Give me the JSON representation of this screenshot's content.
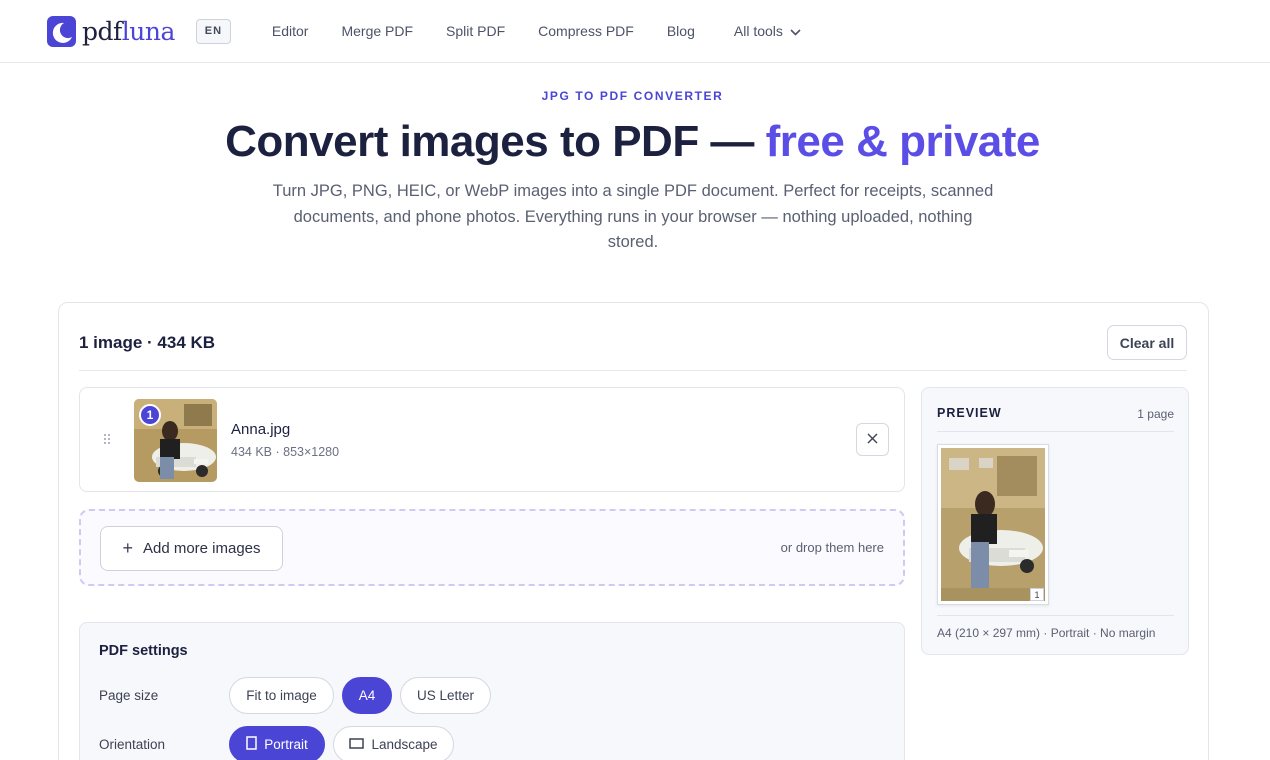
{
  "header": {
    "brand_pdf": "pdf",
    "brand_luna": "luna",
    "lang": "EN",
    "nav": [
      "Editor",
      "Merge PDF",
      "Split PDF",
      "Compress PDF",
      "Blog"
    ],
    "all_tools": "All tools"
  },
  "hero": {
    "eyebrow": "JPG TO PDF CONVERTER",
    "title_main": "Convert images to PDF — ",
    "title_accent": "free & private",
    "subtitle": "Turn JPG, PNG, HEIC, or WebP images into a single PDF document. Perfect for receipts, scanned documents, and phone photos. Everything runs in your browser — nothing uploaded, nothing stored."
  },
  "workspace": {
    "count": "1 image · 434 KB",
    "clear_all": "Clear all",
    "files": [
      {
        "index": "1",
        "name": "Anna.jpg",
        "meta": "434 KB · 853×1280"
      }
    ],
    "add_more": "Add more images",
    "drop_hint": "or drop them here"
  },
  "settings": {
    "title": "PDF settings",
    "page_size_label": "Page size",
    "page_sizes": [
      "Fit to image",
      "A4",
      "US Letter"
    ],
    "page_size_selected": "A4",
    "orientation_label": "Orientation",
    "orientations": [
      "Portrait",
      "Landscape"
    ],
    "orientation_selected": "Portrait"
  },
  "preview": {
    "title": "PREVIEW",
    "pages": "1 page",
    "page_number": "1",
    "meta": "A4 (210 × 297 mm) · Portrait · No margin"
  },
  "colors": {
    "accent": "#4b45d6",
    "accent_light": "#5b4ee6",
    "text_dark": "#1d2140"
  }
}
